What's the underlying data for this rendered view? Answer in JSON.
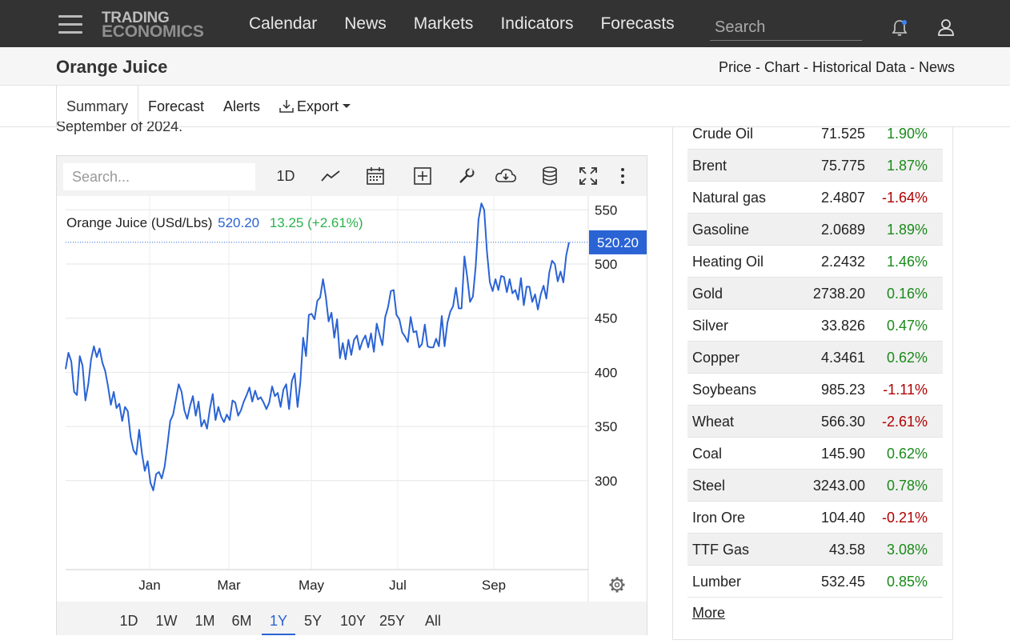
{
  "nav": {
    "logo_line1": "TRADING",
    "logo_line2": "ECONOMICS",
    "links": [
      "Calendar",
      "News",
      "Markets",
      "Indicators",
      "Forecasts"
    ],
    "search_placeholder": "Search"
  },
  "header": {
    "title": "Orange Juice",
    "crumbs": "Price - Chart - Historical Data - News"
  },
  "subnav": {
    "tabs": [
      "Summary",
      "Forecast",
      "Alerts"
    ],
    "export_label": "Export",
    "active": "Summary"
  },
  "article_fragment": "September of 2024.",
  "chart_toolbar": {
    "search_placeholder": "Search...",
    "interval": "1D"
  },
  "chart_legend": {
    "name": "Orange Juice (USd/Lbs)",
    "price": "520.20",
    "change": "13.25 (+2.61%)"
  },
  "ranges": [
    "1D",
    "1W",
    "1M",
    "6M",
    "1Y",
    "5Y",
    "10Y",
    "25Y",
    "All"
  ],
  "active_range": "1Y",
  "colors": {
    "line": "#2a63d4",
    "positive": "#1a8a1a",
    "negative": "#b00000",
    "nav_bg": "#333333"
  },
  "chart_data": {
    "type": "line",
    "title": "Orange Juice (USd/Lbs)",
    "xlabel": "",
    "ylabel": "",
    "x_ticks": [
      "Jan",
      "Mar",
      "May",
      "Jul",
      "Sep"
    ],
    "y_ticks": [
      300,
      350,
      400,
      450,
      500,
      550
    ],
    "ylim": [
      250,
      600
    ],
    "last_value_label": "520.20",
    "grid": true,
    "series": [
      {
        "name": "Orange Juice",
        "x_index": [
          0,
          1,
          2,
          3,
          4,
          5,
          6,
          7,
          8,
          9,
          10,
          11,
          12,
          13,
          14,
          15,
          16,
          17,
          18,
          19,
          20,
          21,
          22,
          23,
          24,
          25,
          26,
          27,
          28,
          29,
          30,
          31,
          32,
          33,
          34,
          35,
          36,
          37,
          38,
          39,
          40,
          41,
          42,
          43,
          44,
          45,
          46,
          47,
          48,
          49,
          50,
          51,
          52,
          53,
          54,
          55,
          56,
          57,
          58,
          59,
          60,
          61,
          62,
          63,
          64,
          65,
          66,
          67,
          68,
          69,
          70,
          71,
          72,
          73,
          74,
          75,
          76,
          77,
          78,
          79,
          80,
          81,
          82,
          83,
          84,
          85,
          86,
          87,
          88,
          89,
          90,
          91,
          92,
          93,
          94,
          95,
          96,
          97,
          98,
          99,
          100,
          101,
          102,
          103,
          104,
          105,
          106,
          107,
          108,
          109,
          110,
          111,
          112,
          113,
          114,
          115,
          116,
          117,
          118,
          119,
          120,
          121,
          122,
          123,
          124,
          125,
          126,
          127,
          128,
          129,
          130,
          131,
          132,
          133,
          134,
          135,
          136,
          137,
          138,
          139,
          140,
          141,
          142,
          143,
          144,
          145,
          146,
          147,
          148,
          149,
          150,
          151,
          152,
          153,
          154,
          155,
          156,
          157,
          158,
          159,
          160,
          161,
          162,
          163,
          164,
          165,
          166,
          167,
          168,
          169,
          170,
          171,
          172,
          173,
          174,
          175,
          176,
          177,
          178,
          179,
          180,
          181,
          182,
          183,
          184,
          185,
          186,
          187,
          188,
          189,
          190,
          191,
          192,
          193,
          194,
          195,
          196,
          197,
          198,
          199,
          200,
          201,
          202,
          203,
          204,
          205,
          206,
          207,
          208,
          209,
          210,
          211,
          212,
          213,
          214,
          215,
          216,
          217,
          218,
          219,
          220,
          221,
          222,
          223,
          224,
          225,
          226,
          227,
          228,
          229,
          230,
          231,
          232,
          233,
          234,
          235,
          236,
          237,
          238,
          239
        ],
        "values": [
          403,
          418,
          410,
          382,
          379,
          415,
          406,
          374,
          389,
          412,
          424,
          414,
          422,
          409,
          401,
          387,
          370,
          382,
          367,
          371,
          355,
          368,
          364,
          340,
          328,
          324,
          347,
          325,
          309,
          318,
          298,
          291,
          306,
          308,
          302,
          313,
          333,
          355,
          361,
          375,
          389,
          382,
          365,
          357,
          369,
          378,
          360,
          373,
          350,
          356,
          348,
          366,
          380,
          356,
          368,
          359,
          354,
          361,
          356,
          374,
          372,
          360,
          365,
          373,
          379,
          386,
          373,
          383,
          375,
          377,
          372,
          366,
          372,
          387,
          378,
          381,
          368,
          384,
          389,
          366,
          392,
          399,
          368,
          391,
          432,
          415,
          453,
          454,
          449,
          466,
          469,
          486,
          470,
          447,
          455,
          432,
          449,
          413,
          427,
          412,
          430,
          416,
          430,
          434,
          421,
          429,
          434,
          423,
          436,
          419,
          445,
          435,
          425,
          451,
          460,
          475,
          476,
          453,
          449,
          437,
          433,
          428,
          451,
          437,
          438,
          423,
          426,
          444,
          424,
          423,
          423,
          431,
          424,
          452,
          424,
          446,
          456,
          461,
          478,
          459,
          459,
          507,
          488,
          465,
          470,
          498,
          541,
          556,
          550,
          511,
          483,
          475,
          486,
          476,
          489,
          488,
          474,
          486,
          473,
          476,
          467,
          487,
          462,
          479,
          479,
          465,
          472,
          458,
          472,
          480,
          468,
          492,
          503,
          500,
          484,
          493,
          483,
          508,
          520
        ]
      }
    ]
  },
  "commodities": [
    {
      "name": "Crude Oil",
      "price": "71.525",
      "change": "1.90%",
      "dir": "pos"
    },
    {
      "name": "Brent",
      "price": "75.775",
      "change": "1.87%",
      "dir": "pos"
    },
    {
      "name": "Natural gas",
      "price": "2.4807",
      "change": "-1.64%",
      "dir": "neg"
    },
    {
      "name": "Gasoline",
      "price": "2.0689",
      "change": "1.89%",
      "dir": "pos"
    },
    {
      "name": "Heating Oil",
      "price": "2.2432",
      "change": "1.46%",
      "dir": "pos"
    },
    {
      "name": "Gold",
      "price": "2738.20",
      "change": "0.16%",
      "dir": "pos"
    },
    {
      "name": "Silver",
      "price": "33.826",
      "change": "0.47%",
      "dir": "pos"
    },
    {
      "name": "Copper",
      "price": "4.3461",
      "change": "0.62%",
      "dir": "pos"
    },
    {
      "name": "Soybeans",
      "price": "985.23",
      "change": "-1.11%",
      "dir": "neg"
    },
    {
      "name": "Wheat",
      "price": "566.30",
      "change": "-2.61%",
      "dir": "neg"
    },
    {
      "name": "Coal",
      "price": "145.90",
      "change": "0.62%",
      "dir": "pos"
    },
    {
      "name": "Steel",
      "price": "3243.00",
      "change": "0.78%",
      "dir": "pos"
    },
    {
      "name": "Iron Ore",
      "price": "104.40",
      "change": "-0.21%",
      "dir": "neg"
    },
    {
      "name": "TTF Gas",
      "price": "43.58",
      "change": "3.08%",
      "dir": "pos"
    },
    {
      "name": "Lumber",
      "price": "532.45",
      "change": "0.85%",
      "dir": "pos"
    }
  ],
  "more_label": "More"
}
